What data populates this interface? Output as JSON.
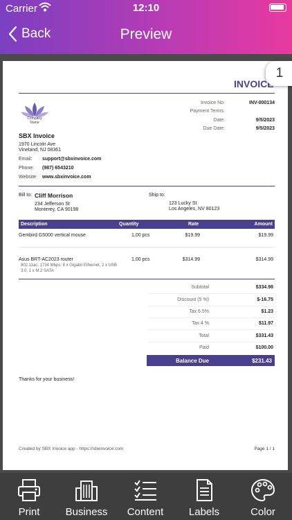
{
  "status": {
    "carrier": "Carrier",
    "time": "12:10"
  },
  "nav": {
    "back_label": "Back",
    "title": "Preview"
  },
  "page_badge": "1",
  "invoice": {
    "title": "INVOICE",
    "meta": [
      {
        "label": "Invoice No:",
        "value": "INV-000134"
      },
      {
        "label": "Payment Terms:",
        "value": ""
      },
      {
        "label": "Date:",
        "value": "9/5/2023"
      },
      {
        "label": "Due Date:",
        "value": "9/5/2023"
      }
    ],
    "logo_text": [
      "Company",
      "Name"
    ],
    "company": {
      "name": "SBX Invoice",
      "address": [
        "1970 Lincoln Ave",
        "Vineland, NJ 08361"
      ],
      "email_label": "Email:",
      "email": "support@sbxinvoice.com",
      "phone_label": "Phone:",
      "phone": "(987) 6543210",
      "website_label": "Website:",
      "website": "www.sbxinvoice.com"
    },
    "bill_to": {
      "label": "Bill to:",
      "name": "Cliff Morrison",
      "address": [
        "234 Jefferson St",
        "Monterey, CA 90198"
      ]
    },
    "ship_to": {
      "label": "Ship to:",
      "address": [
        "123 Lucky St",
        "Los Angeles, NV 80123"
      ]
    },
    "columns": {
      "description": "Description",
      "quantity": "Quantity",
      "rate": "Rate",
      "amount": "Amount"
    },
    "items": [
      {
        "description": "Gembird G5000 vertical mouse",
        "details": "",
        "qty": "1,00 pcs",
        "rate": "$19.99",
        "amount": "$19.99"
      },
      {
        "description": "Asus BRT-AC2023 router",
        "details": "802.11ac; 1734 Mbps; 8 x Gigabit Ethernet, 2 x USB 3.0; 1 x M.2 SATA",
        "qty": "1,00 pcs",
        "rate": "$314.99",
        "amount": "$314.99"
      }
    ],
    "summary": [
      {
        "label": "Subtotal",
        "value": "$334.98"
      },
      {
        "label": "Discount (5 %)",
        "value": "$-16.75"
      },
      {
        "label": "Tax 6.5%",
        "value": "$1.23"
      },
      {
        "label": "Tax 4 %",
        "value": "$11.97"
      },
      {
        "label": "Total",
        "value": "$331.43"
      },
      {
        "label": "Paid",
        "value": "$100.00"
      }
    ],
    "balance": {
      "label": "Balance Due",
      "value": "$231.43"
    },
    "thanks": "Thanks for your business!",
    "footer_left": "Created by SBX Invoice app - https://sbxinvoice.com",
    "footer_right": "Page 1 / 1"
  },
  "toolbar": {
    "print": "Print",
    "business": "Business",
    "content": "Content",
    "labels": "Labels",
    "color": "Color"
  },
  "colors": {
    "accent": "#4a3f8c",
    "gradient_start": "#7b3fc0",
    "gradient_end": "#e8399f",
    "toolbar_bg": "#3e3e3e"
  }
}
